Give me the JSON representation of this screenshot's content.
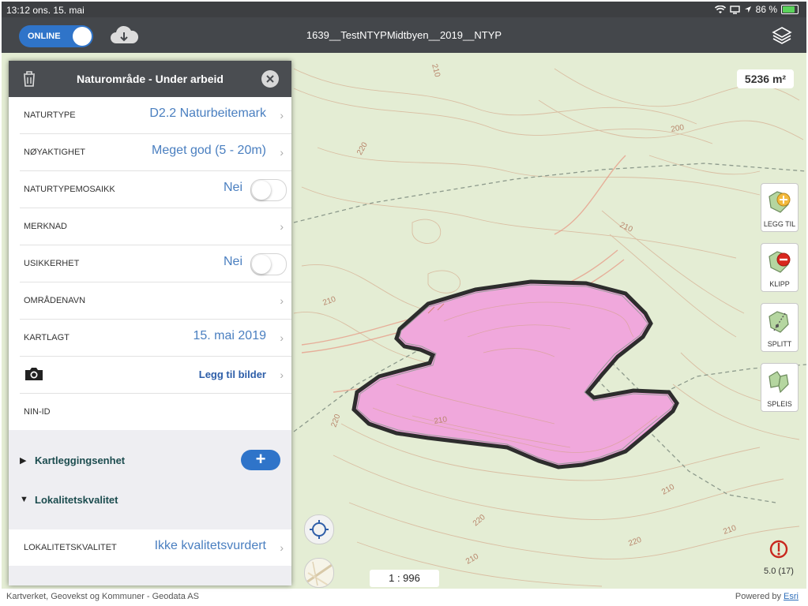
{
  "status_bar": {
    "time": "13:12",
    "date": "ons. 15. mai",
    "battery_text": "86 %",
    "battery_level": 0.86
  },
  "nav": {
    "online_label": "ONLINE",
    "title": "1639__TestNTYPMidtbyen__2019__NTYP"
  },
  "map": {
    "area_label": "5236 m²",
    "contour_labels": [
      "210",
      "200",
      "220",
      "210",
      "210",
      "210",
      "220",
      "220",
      "210",
      "220",
      "210",
      "210"
    ],
    "scale": "1 : 996",
    "gps_accuracy": "5.0 (17)",
    "polygon_fill": "#f0a8dc",
    "polygon_stroke": "#2d2d2d"
  },
  "tools": [
    {
      "label": "LEGG TIL",
      "icon": "add-polygon-icon"
    },
    {
      "label": "KLIPP",
      "icon": "cut-polygon-icon"
    },
    {
      "label": "SPLITT",
      "icon": "split-polygon-icon"
    },
    {
      "label": "SPLEIS",
      "icon": "merge-polygon-icon"
    }
  ],
  "panel": {
    "title": "Naturområde - Under arbeid",
    "rows": [
      {
        "key": "NATURTYPE",
        "value": "D2.2 Naturbeitemark"
      },
      {
        "key": "NØYAKTIGHET",
        "value": "Meget god (5 - 20m)"
      },
      {
        "key": "NATURTYPEMOSAIKK",
        "value": "Nei"
      },
      {
        "key": "MERKNAD",
        "value": ""
      },
      {
        "key": "USIKKERHET",
        "value": "Nei"
      },
      {
        "key": "OMRÅDENAVN",
        "value": ""
      },
      {
        "key": "KARTLAGT",
        "value": "15. mai 2019"
      },
      {
        "key": "",
        "value": "Legg til bilder"
      },
      {
        "key": "NIN-ID",
        "value": ""
      }
    ],
    "section_kartlegging": "Kartleggingsenhet",
    "section_lokalitet": "Lokalitetskvalitet",
    "lokalitet_row": {
      "key": "LOKALITETSKVALITET",
      "value": "Ikke kvalitetsvurdert"
    }
  },
  "attribution": {
    "left": "Kartverket, Geovekst og Kommuner - Geodata AS",
    "right_prefix": "Powered by ",
    "right_link": "Esri"
  }
}
